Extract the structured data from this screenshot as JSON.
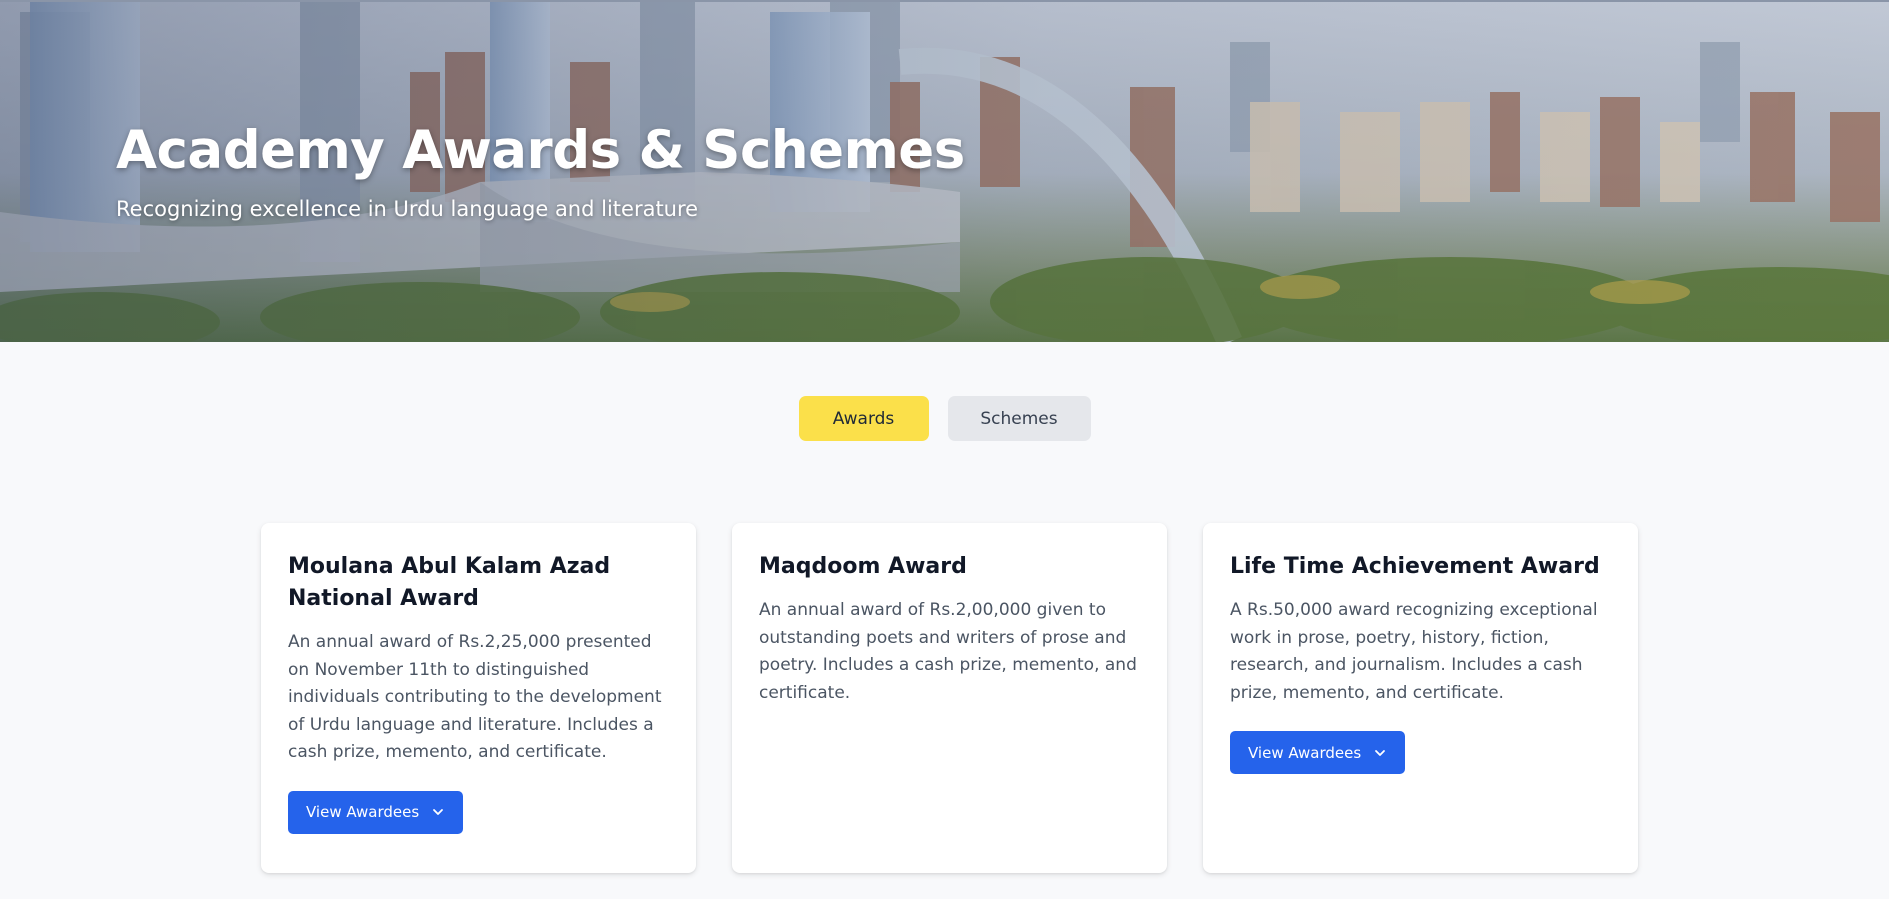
{
  "hero": {
    "title": "Academy Awards & Schemes",
    "subtitle": "Recognizing excellence in Urdu language and literature"
  },
  "tabs": [
    {
      "label": "Awards",
      "active": true
    },
    {
      "label": "Schemes",
      "active": false
    }
  ],
  "awards": [
    {
      "title": "Moulana Abul Kalam Azad National Award",
      "description": "An annual award of Rs.2,25,000 presented on November 11th to distinguished individuals contributing to the development of Urdu language and literature. Includes a cash prize, memento, and certificate.",
      "button_label": "View Awardees",
      "button_icon": "chevron-down-icon"
    },
    {
      "title": "Maqdoom Award",
      "description": "An annual award of Rs.2,00,000 given to outstanding poets and writers of prose and poetry. Includes a cash prize, memento, and certificate."
    },
    {
      "title": "Life Time Achievement Award",
      "description": "A Rs.50,000 award recognizing exceptional work in prose, poetry, history, fiction, research, and journalism. Includes a cash prize, memento, and certificate.",
      "button_label": "View Awardees",
      "button_icon": "chevron-down-icon"
    }
  ],
  "colors": {
    "accent_yellow": "#fbe04a",
    "primary_blue": "#2563eb",
    "inactive_tab": "#e5e7eb",
    "page_background": "#f8f9fb"
  }
}
